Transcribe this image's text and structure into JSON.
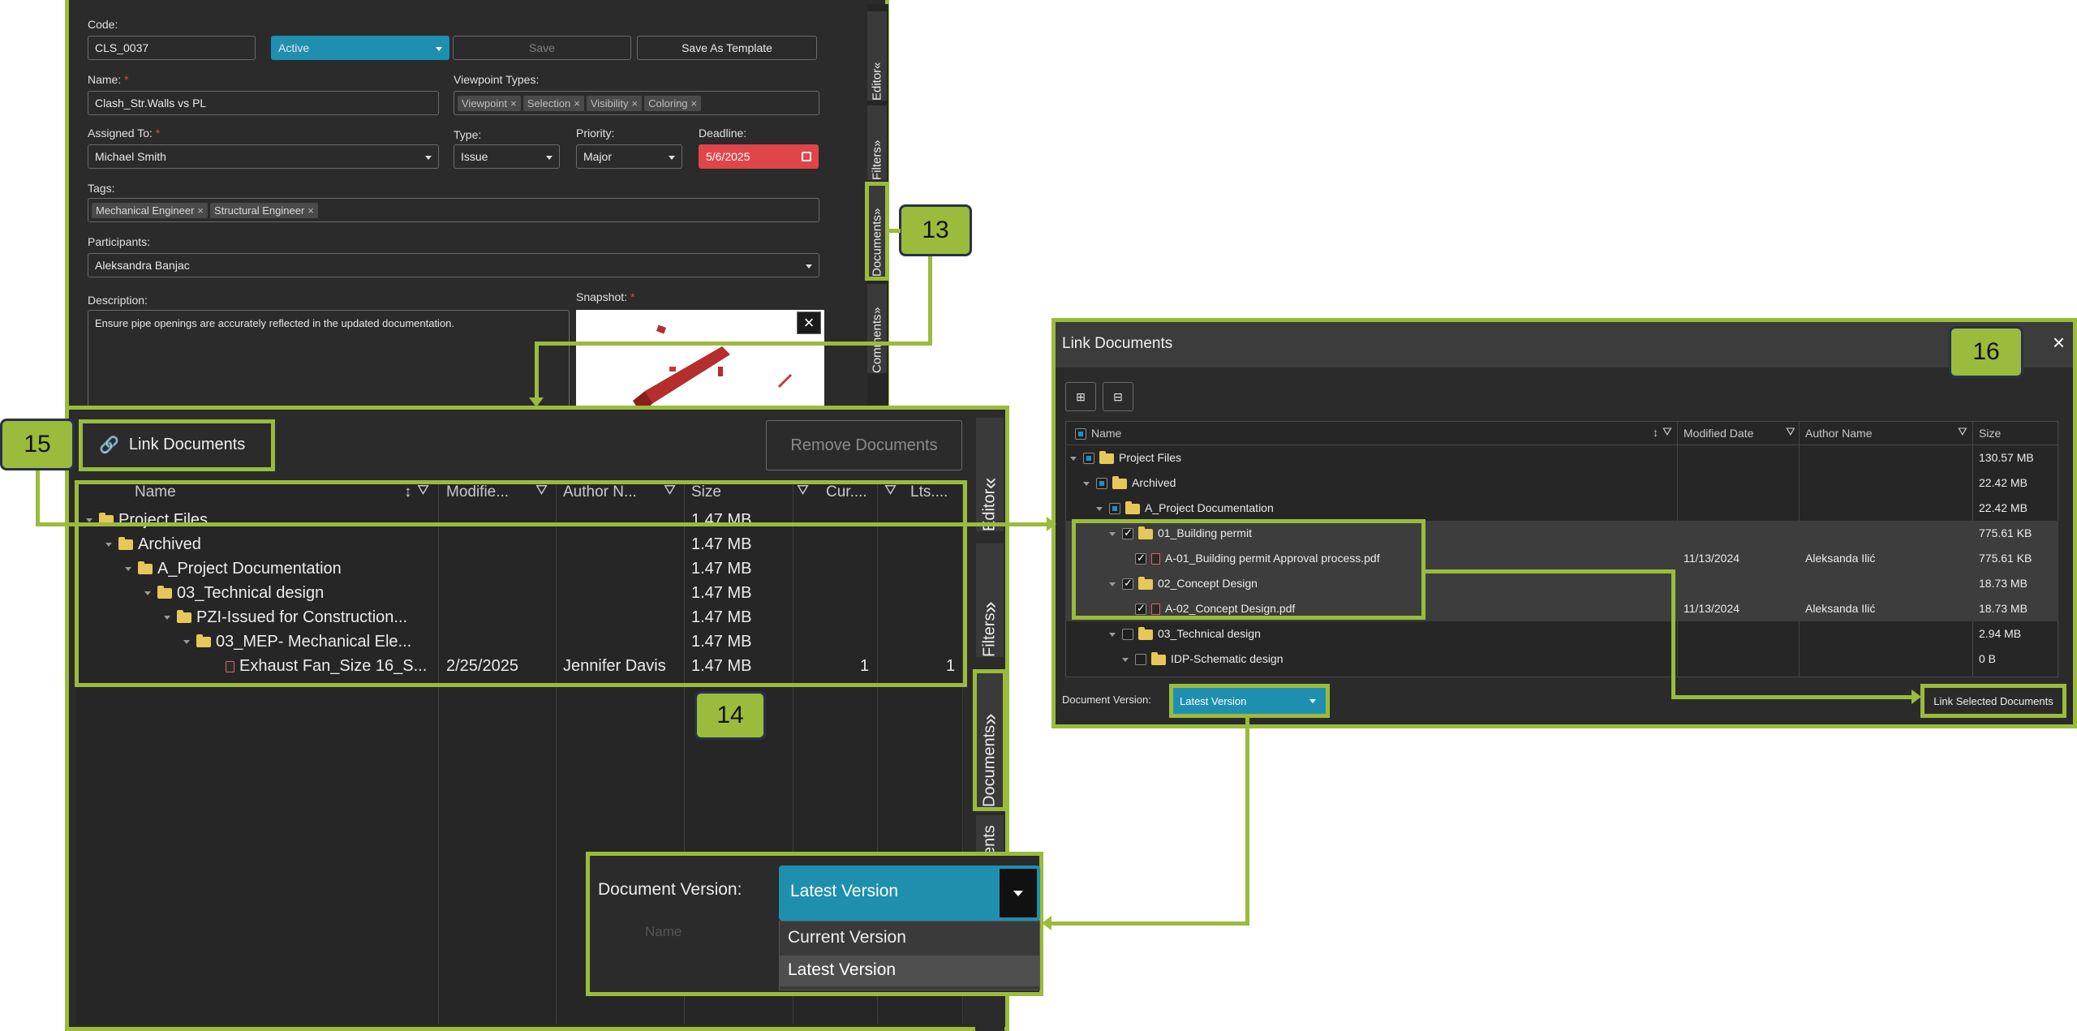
{
  "form": {
    "code_label": "Code:",
    "code_value": "CLS_0037",
    "status_value": "Active",
    "save_label": "Save",
    "save_template_label": "Save As Template",
    "name_label": "Name:",
    "name_value": "Clash_Str.Walls vs PL",
    "viewpoint_types_label": "Viewpoint Types:",
    "viewpoint_types": [
      "Viewpoint",
      "Selection",
      "Visibility",
      "Coloring"
    ],
    "assigned_label": "Assigned To:",
    "assigned_value": "Michael Smith",
    "type_label": "Type:",
    "type_value": "Issue",
    "priority_label": "Priority:",
    "priority_value": "Major",
    "deadline_label": "Deadline:",
    "deadline_value": "5/6/2025",
    "tags_label": "Tags:",
    "tags": [
      "Mechanical Engineer",
      "Structural Engineer"
    ],
    "participants_label": "Participants:",
    "participants_value": "Aleksandra Banjac",
    "description_label": "Description:",
    "description_value": "Ensure pipe openings are accurately reflected in the updated documentation.",
    "snapshot_label": "Snapshot:",
    "required_mark": "*",
    "side_tabs": [
      "Editor",
      "Filters",
      "Documents",
      "Comments"
    ]
  },
  "docs_panel": {
    "link_label": "Link Documents",
    "remove_label": "Remove Documents",
    "columns": [
      "Name",
      "Modifie...",
      "Author N...",
      "Size",
      "Cur....",
      "Lts...."
    ],
    "rows": [
      {
        "name": "Project Files",
        "modified": "",
        "author": "",
        "size": "1.47 MB",
        "cur": "",
        "lts": ""
      },
      {
        "name": "Archived",
        "modified": "",
        "author": "",
        "size": "1.47 MB",
        "cur": "",
        "lts": ""
      },
      {
        "name": "A_Project Documentation",
        "modified": "",
        "author": "",
        "size": "1.47 MB",
        "cur": "",
        "lts": ""
      },
      {
        "name": "03_Technical design",
        "modified": "",
        "author": "",
        "size": "1.47 MB",
        "cur": "",
        "lts": ""
      },
      {
        "name": "PZI-Issued for Construction...",
        "modified": "",
        "author": "",
        "size": "1.47 MB",
        "cur": "",
        "lts": ""
      },
      {
        "name": "03_MEP- Mechanical Ele...",
        "modified": "",
        "author": "",
        "size": "1.47 MB",
        "cur": "",
        "lts": ""
      },
      {
        "name": "Exhaust Fan_Size 16_S...",
        "modified": "2/25/2025",
        "author": "Jennifer Davis",
        "size": "1.47 MB",
        "cur": "1",
        "lts": "1"
      }
    ],
    "side_tabs": [
      "Editor",
      "Filters",
      "Documents",
      "ents"
    ],
    "version_label": "Document Version:",
    "version_value": "Latest Version",
    "version_options": [
      "Current Version",
      "Latest Version"
    ],
    "hidden_text": "Name"
  },
  "dialog": {
    "title": "Link Documents",
    "close": "×",
    "columns": [
      "Name",
      "Modified Date",
      "Author Name",
      "Size"
    ],
    "rows": [
      {
        "name": "Project Files",
        "modified": "",
        "author": "",
        "size": "130.57 MB"
      },
      {
        "name": "Archived",
        "modified": "",
        "author": "",
        "size": "22.42 MB"
      },
      {
        "name": "A_Project Documentation",
        "modified": "",
        "author": "",
        "size": "22.42 MB"
      },
      {
        "name": "01_Building permit",
        "modified": "",
        "author": "",
        "size": "775.61 KB"
      },
      {
        "name": "A-01_Building permit Approval process.pdf",
        "modified": "11/13/2024",
        "author": "Aleksanda Ilić",
        "size": "775.61 KB"
      },
      {
        "name": "02_Concept Design",
        "modified": "",
        "author": "",
        "size": "18.73 MB"
      },
      {
        "name": "A-02_Concept Design.pdf",
        "modified": "11/13/2024",
        "author": "Aleksanda Ilić",
        "size": "18.73 MB"
      },
      {
        "name": "03_Technical design",
        "modified": "",
        "author": "",
        "size": "2.94 MB"
      },
      {
        "name": "IDP-Schematic design",
        "modified": "",
        "author": "",
        "size": "0 B"
      }
    ],
    "version_label": "Document Version:",
    "version_value": "Latest Version",
    "link_selected_label": "Link Selected Documents"
  },
  "callouts": [
    "13",
    "14",
    "15",
    "16"
  ],
  "colors": {
    "accent": "#9bbb3c",
    "teal": "#1f8fb0",
    "danger": "#e0454a",
    "panel": "#2b2b2b"
  }
}
